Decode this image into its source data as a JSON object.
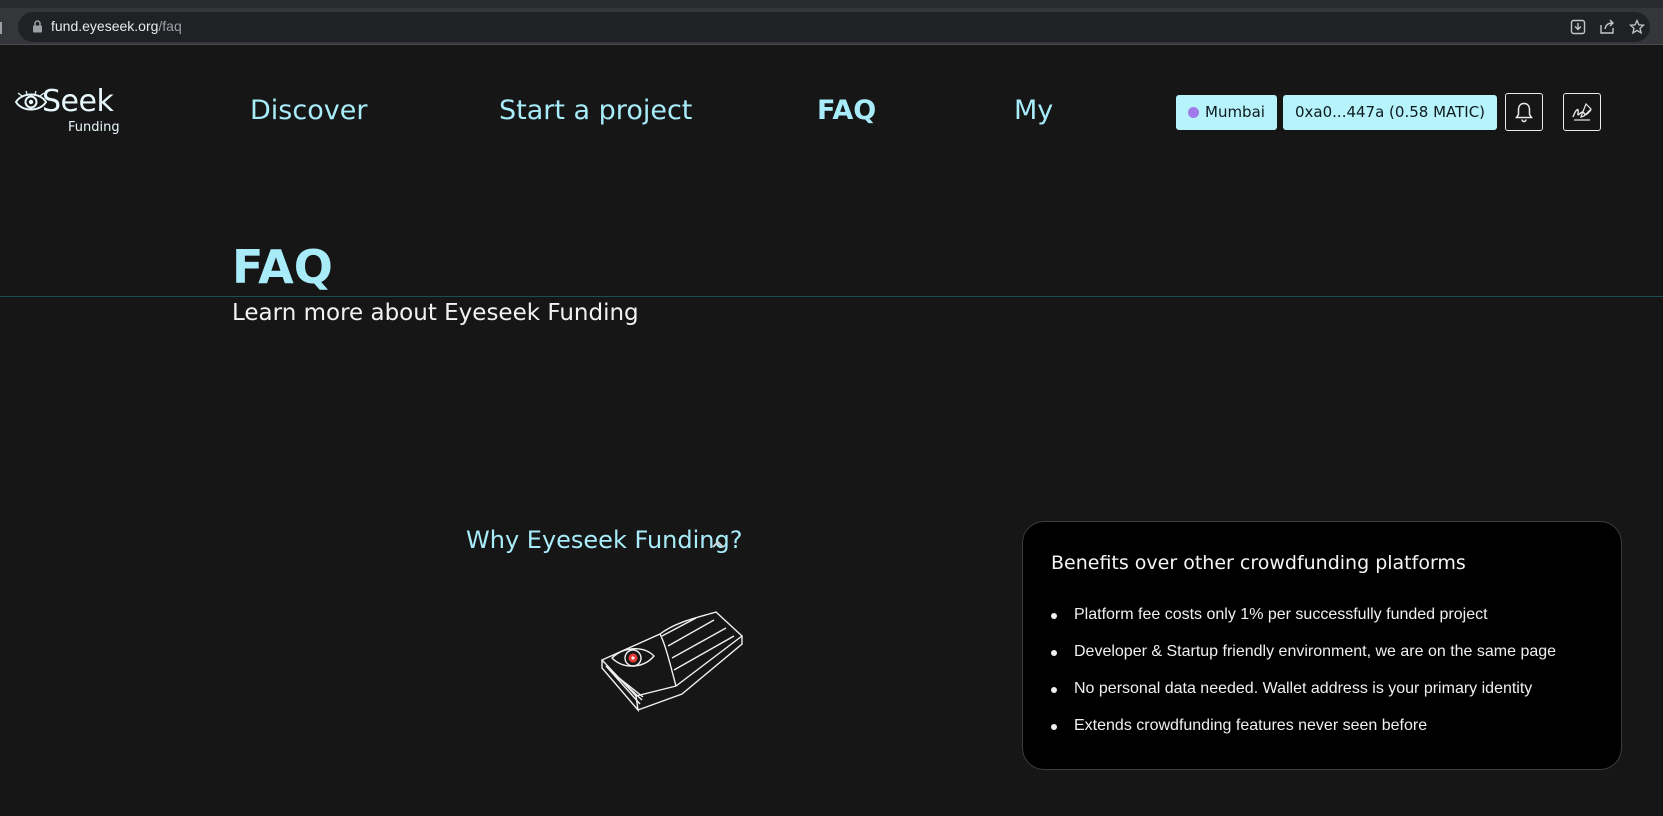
{
  "browser": {
    "url_host": "fund.eyeseek.org",
    "url_path": "/faq"
  },
  "header": {
    "logo_word": "Seek",
    "logo_sub": "Funding",
    "nav": [
      {
        "label": "Discover"
      },
      {
        "label": "Start a project"
      },
      {
        "label": "FAQ"
      },
      {
        "label": "My"
      }
    ],
    "network_label": "Mumbai",
    "wallet_label": "0xa0...447a (0.58 MATIC)"
  },
  "hero": {
    "title": "FAQ",
    "subtitle": "Learn more about Eyeseek Funding"
  },
  "accordion": {
    "question": "Why Eyeseek Funding?"
  },
  "card": {
    "title": "Benefits over other crowdfunding platforms",
    "items": [
      "Platform fee costs only 1% per successfully funded project",
      "Developer & Startup friendly environment, we are on the same page",
      "No personal data needed. Wallet address is your primary identity",
      "Extends crowdfunding features never seen before"
    ]
  },
  "colors": {
    "accent": "#a8ecfa",
    "pill_bg": "#b7f3fb",
    "page_bg": "#161616",
    "card_bg": "#000000",
    "network_dot": "#9f7aea"
  },
  "icons": {
    "lock": "lock-icon",
    "install": "install-icon",
    "share": "share-icon",
    "bookmark": "star-icon",
    "notifications": "bell-icon",
    "profile": "signature-icon",
    "expand": "chevron-up-icon",
    "illustration": "book-eye-illustration"
  }
}
